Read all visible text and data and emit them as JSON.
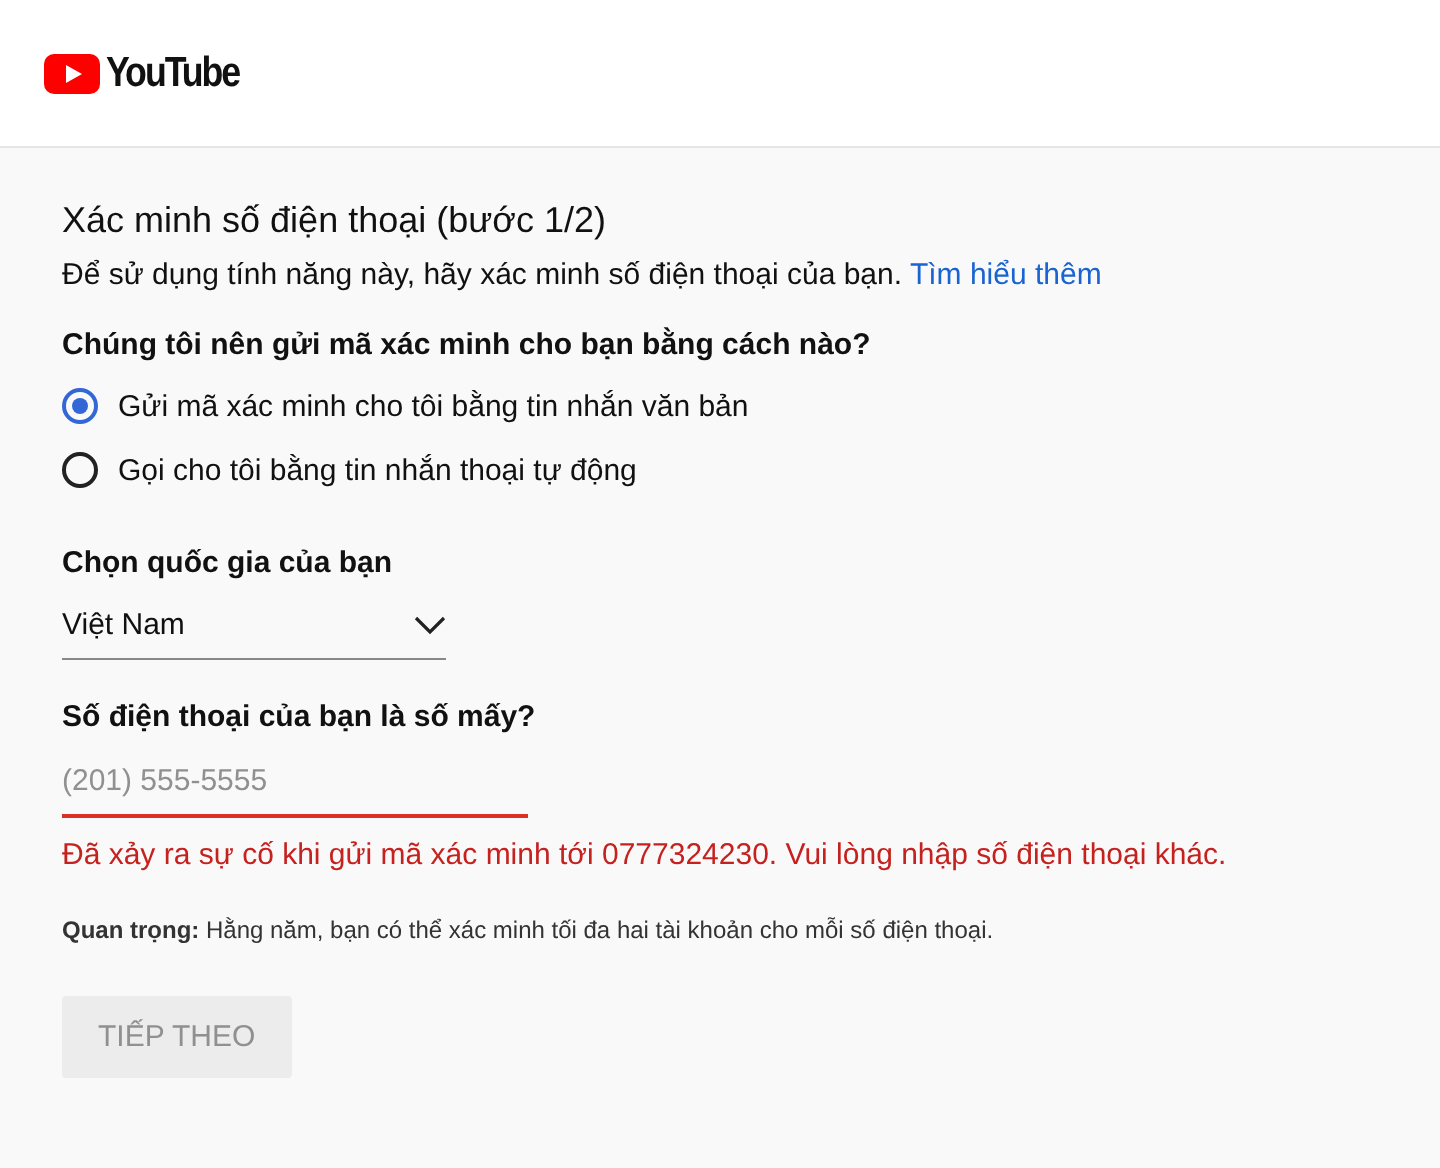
{
  "header": {
    "logo_text": "YouTube"
  },
  "form": {
    "title": "Xác minh số điện thoại (bước 1/2)",
    "description": "Để sử dụng tính năng này, hãy xác minh số điện thoại của bạn.",
    "learn_more_link": "Tìm hiểu thêm",
    "method_question": "Chúng tôi nên gửi mã xác minh cho bạn bằng cách nào?",
    "methods": [
      {
        "label": "Gửi mã xác minh cho tôi bằng tin nhắn văn bản",
        "selected": true
      },
      {
        "label": "Gọi cho tôi bằng tin nhắn thoại tự động",
        "selected": false
      }
    ],
    "country_label": "Chọn quốc gia của bạn",
    "country_value": "Việt Nam",
    "phone_label": "Số điện thoại của bạn là số mấy?",
    "phone_placeholder": "(201) 555-5555",
    "error": "Đã xảy ra sự cố khi gửi mã xác minh tới 0777324230. Vui lòng nhập số điện thoại khác.",
    "note": "**Quan trọng:** Hằng năm, bạn có thể xác minh tối đa hai tài khoản cho mỗi số điện thoại.",
    "next_button": {
      "label": "TIẾP THEO",
      "disabled": true
    }
  }
}
